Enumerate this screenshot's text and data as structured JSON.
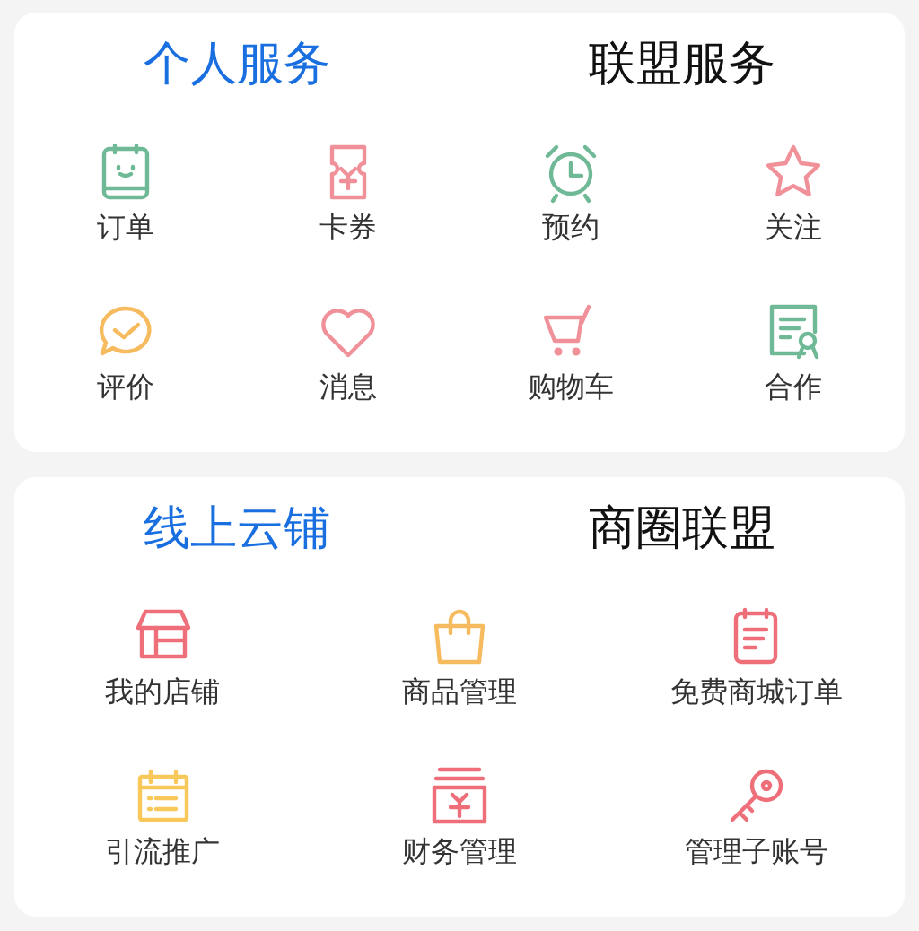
{
  "sections": [
    {
      "tabs": [
        {
          "label": "个人服务",
          "selected": true
        },
        {
          "label": "联盟服务",
          "selected": false
        }
      ],
      "items": [
        {
          "label": "订单"
        },
        {
          "label": "卡券"
        },
        {
          "label": "预约"
        },
        {
          "label": "关注"
        },
        {
          "label": "评价"
        },
        {
          "label": "消息"
        },
        {
          "label": "购物车"
        },
        {
          "label": "合作"
        }
      ]
    },
    {
      "tabs": [
        {
          "label": "线上云铺",
          "selected": true
        },
        {
          "label": "商圈联盟",
          "selected": false
        }
      ],
      "items": [
        {
          "label": "我的店铺"
        },
        {
          "label": "商品管理"
        },
        {
          "label": "免费商城订单"
        },
        {
          "label": "引流推广"
        },
        {
          "label": "财务管理"
        },
        {
          "label": "管理子账号"
        }
      ]
    }
  ]
}
